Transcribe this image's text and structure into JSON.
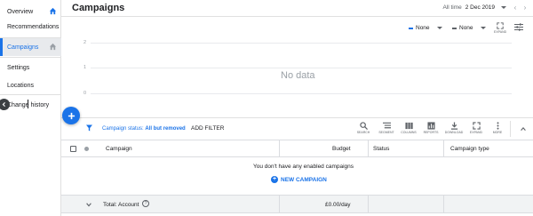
{
  "sidebar": {
    "items": [
      {
        "label": "Overview"
      },
      {
        "label": "Recommendations"
      },
      {
        "label": "Campaigns"
      },
      {
        "label": "Settings"
      },
      {
        "label": "Locations"
      },
      {
        "label": "Change history"
      }
    ]
  },
  "header": {
    "title": "Campaigns",
    "date_range_label": "All time",
    "date_value": "2 Dec 2019"
  },
  "chart": {
    "metric_1": "None",
    "metric_2": "None",
    "metric_1_color": "#1a73e8",
    "metric_2_color": "#5f6368",
    "expand_label": "EXPAND",
    "no_data": "No data",
    "y_ticks": [
      "2",
      "1",
      "0"
    ]
  },
  "filter": {
    "status_label": "Campaign status:",
    "status_value": "All but removed",
    "add_filter": "ADD FILTER"
  },
  "toolbar": [
    {
      "label": "SEARCH",
      "icon": "search-icon"
    },
    {
      "label": "SEGMENT",
      "icon": "segment-icon"
    },
    {
      "label": "COLUMNS",
      "icon": "columns-icon"
    },
    {
      "label": "REPORTS",
      "icon": "reports-icon"
    },
    {
      "label": "DOWNLOAD",
      "icon": "download-icon"
    },
    {
      "label": "EXPAND",
      "icon": "expand-icon"
    },
    {
      "label": "MORE",
      "icon": "more-icon"
    }
  ],
  "table": {
    "columns": [
      "Campaign",
      "Budget",
      "Status",
      "Campaign type"
    ],
    "empty_message": "You don't have any enabled campaigns",
    "new_campaign": "NEW CAMPAIGN",
    "total_label": "Total: Account",
    "total_budget": "£0.00/day"
  },
  "colors": {
    "accent": "#1a73e8"
  }
}
